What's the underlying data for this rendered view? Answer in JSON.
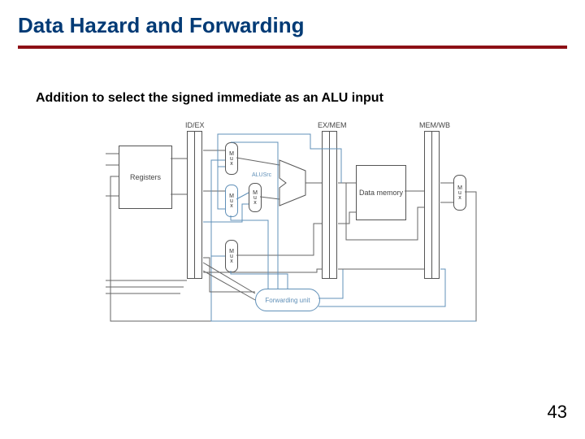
{
  "slide": {
    "title": "Data Hazard and Forwarding",
    "subtitle": "Addition to select the signed immediate as an ALU input",
    "page_number": "43"
  },
  "diagram": {
    "pipeline_registers": [
      "ID/EX",
      "EX/MEM",
      "MEM/WB"
    ],
    "blocks": {
      "registers": "Registers",
      "alu": "ALU",
      "alusrc": "ALUSrc",
      "data_memory": "Data\nmemory",
      "forwarding_unit": "Forwarding\nunit"
    },
    "muxes": [
      "Mux",
      "Mux",
      "Mux",
      "Mux",
      "Mux"
    ]
  }
}
